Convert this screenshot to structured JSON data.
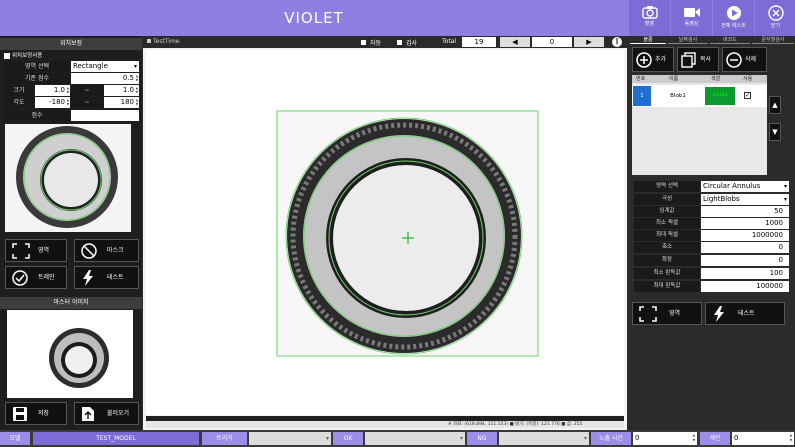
{
  "app": {
    "title": "VIOLET"
  },
  "header_buttons": [
    {
      "label": "촬영"
    },
    {
      "label": "동영상"
    },
    {
      "label": "전체 테스트"
    },
    {
      "label": "닫기"
    }
  ],
  "left": {
    "title": "위치보정",
    "use_checkbox_label": "위치보정사용",
    "region_select_label": "영역 선택",
    "region_select_value": "Rectangle",
    "score_label": "기준 점수",
    "score_value": "0.5",
    "size_label": "크기",
    "size_min": "1.0",
    "size_max": "1.0",
    "angle_label": "각도",
    "angle_min": "-180",
    "angle_max": "180",
    "range_sep": "~",
    "result_label": "점수",
    "result_value": "",
    "btn_region": "영역",
    "btn_mask": "마스크",
    "btn_train": "트레인",
    "btn_test": "테스트",
    "master_title": "마스터 이미지",
    "btn_save": "저장",
    "btn_load": "불러오기"
  },
  "center": {
    "window_label": "TestTime",
    "check_auto": "자동",
    "check_inspect": "검사",
    "total_label": "Total",
    "total_value": "19",
    "nav_value": "0",
    "status_text": "# 좌표: (618.894, 111.553) ■ 밝기: (측정): 121.776 ■ 값: 255"
  },
  "right": {
    "tabs": [
      "블롭",
      "날짜검사",
      "바코드",
      "문자열검사"
    ],
    "btn_add": "추가",
    "btn_copy": "복사",
    "btn_delete": "삭제",
    "table_headers": [
      "번호",
      "이름",
      "색깔",
      "사용"
    ],
    "table_rows": [
      {
        "no": "1",
        "name": "Blob1",
        "color": "#0a9a2e",
        "color_label": "23334"
      }
    ],
    "props": [
      {
        "label": "영역 선택",
        "value": "Circular Annulus",
        "select": true
      },
      {
        "label": "극성",
        "value": "LightBlobs",
        "select": true
      },
      {
        "label": "임계값",
        "value": "50"
      },
      {
        "label": "최소 픽셀",
        "value": "1000"
      },
      {
        "label": "최대 픽셀",
        "value": "1000000"
      },
      {
        "label": "축소",
        "value": "0"
      },
      {
        "label": "확장",
        "value": "0"
      },
      {
        "label": "최소 판독값",
        "value": "100"
      },
      {
        "label": "최대 판독값",
        "value": "100000"
      }
    ],
    "btn_region": "영역",
    "btn_test": "테스트"
  },
  "footer": {
    "model_label": "모델",
    "model_value": "TEST_MODEL",
    "trigger_label": "트리거",
    "ok_label": "OK",
    "ng_label": "NG",
    "exposure_label": "노출 시간",
    "exposure_value": "0",
    "gain_label": "게인",
    "gain_value": "0"
  }
}
